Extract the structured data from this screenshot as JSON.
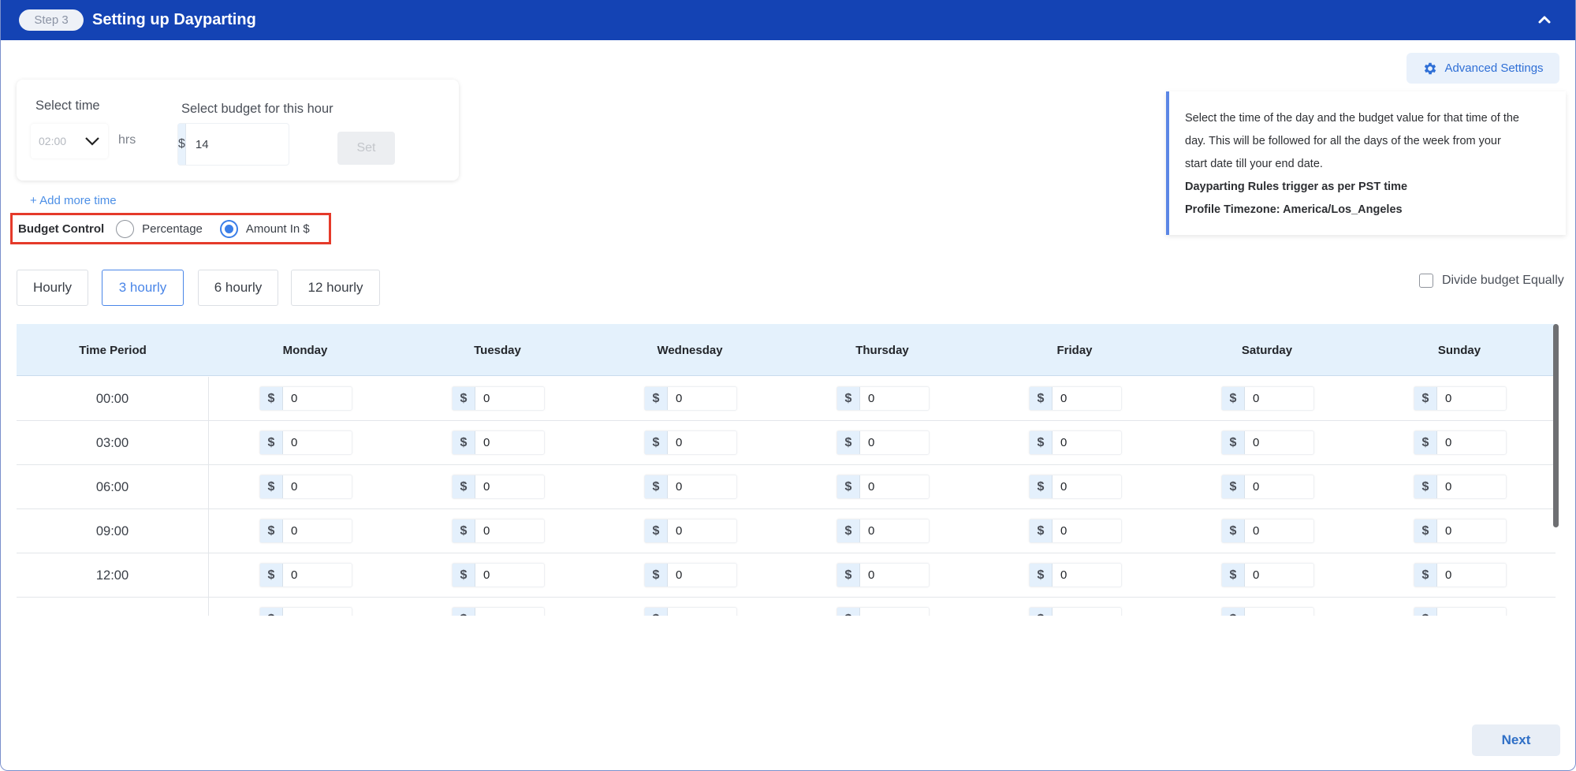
{
  "header": {
    "step_label": "Step 3",
    "title": "Setting up Dayparting",
    "collapse_icon": "chevron-up-icon"
  },
  "advanced_settings": {
    "label": "Advanced Settings",
    "icon": "gear-icon",
    "color": "#2f6fd6"
  },
  "info": {
    "line1": "Select the time of the day and the budget value for that time of the",
    "line2": "day. This will be followed for all the days of the week from your",
    "line3": "start date till your end date.",
    "rule": "Dayparting Rules trigger as per PST time",
    "timezone": "Profile Timezone: America/Los_Angeles"
  },
  "selector": {
    "time_label": "Select time",
    "time_value": "02:00",
    "time_unit": "hrs",
    "budget_label": "Select budget for this hour",
    "currency": "$",
    "budget_value": "14",
    "set_label": "Set"
  },
  "add_more_time": "+ Add more time",
  "budget_control": {
    "label": "Budget Control",
    "options": [
      {
        "label": "Percentage",
        "checked": false
      },
      {
        "label": "Amount In $",
        "checked": true
      }
    ]
  },
  "frequency_tabs": [
    {
      "label": "Hourly",
      "active": false
    },
    {
      "label": "3 hourly",
      "active": true
    },
    {
      "label": "6 hourly",
      "active": false
    },
    {
      "label": "12 hourly",
      "active": false
    }
  ],
  "divide_equally": {
    "label": "Divide budget Equally",
    "checked": false
  },
  "table": {
    "columns": [
      "Time Period",
      "Monday",
      "Tuesday",
      "Wednesday",
      "Thursday",
      "Friday",
      "Saturday",
      "Sunday"
    ],
    "currency": "$",
    "rows": [
      {
        "time": "00:00",
        "values": [
          "0",
          "0",
          "0",
          "0",
          "0",
          "0",
          "0"
        ]
      },
      {
        "time": "03:00",
        "values": [
          "0",
          "0",
          "0",
          "0",
          "0",
          "0",
          "0"
        ]
      },
      {
        "time": "06:00",
        "values": [
          "0",
          "0",
          "0",
          "0",
          "0",
          "0",
          "0"
        ]
      },
      {
        "time": "09:00",
        "values": [
          "0",
          "0",
          "0",
          "0",
          "0",
          "0",
          "0"
        ]
      },
      {
        "time": "12:00",
        "values": [
          "0",
          "0",
          "0",
          "0",
          "0",
          "0",
          "0"
        ]
      },
      {
        "time": "",
        "values": [
          "",
          "",
          "",
          "",
          "",
          "",
          ""
        ]
      }
    ]
  },
  "next_label": "Next",
  "colors": {
    "header_bg": "#1443b4",
    "accent": "#3a7ee8",
    "highlight_border": "#e53a2a",
    "table_header_bg": "#e4f1fc"
  }
}
